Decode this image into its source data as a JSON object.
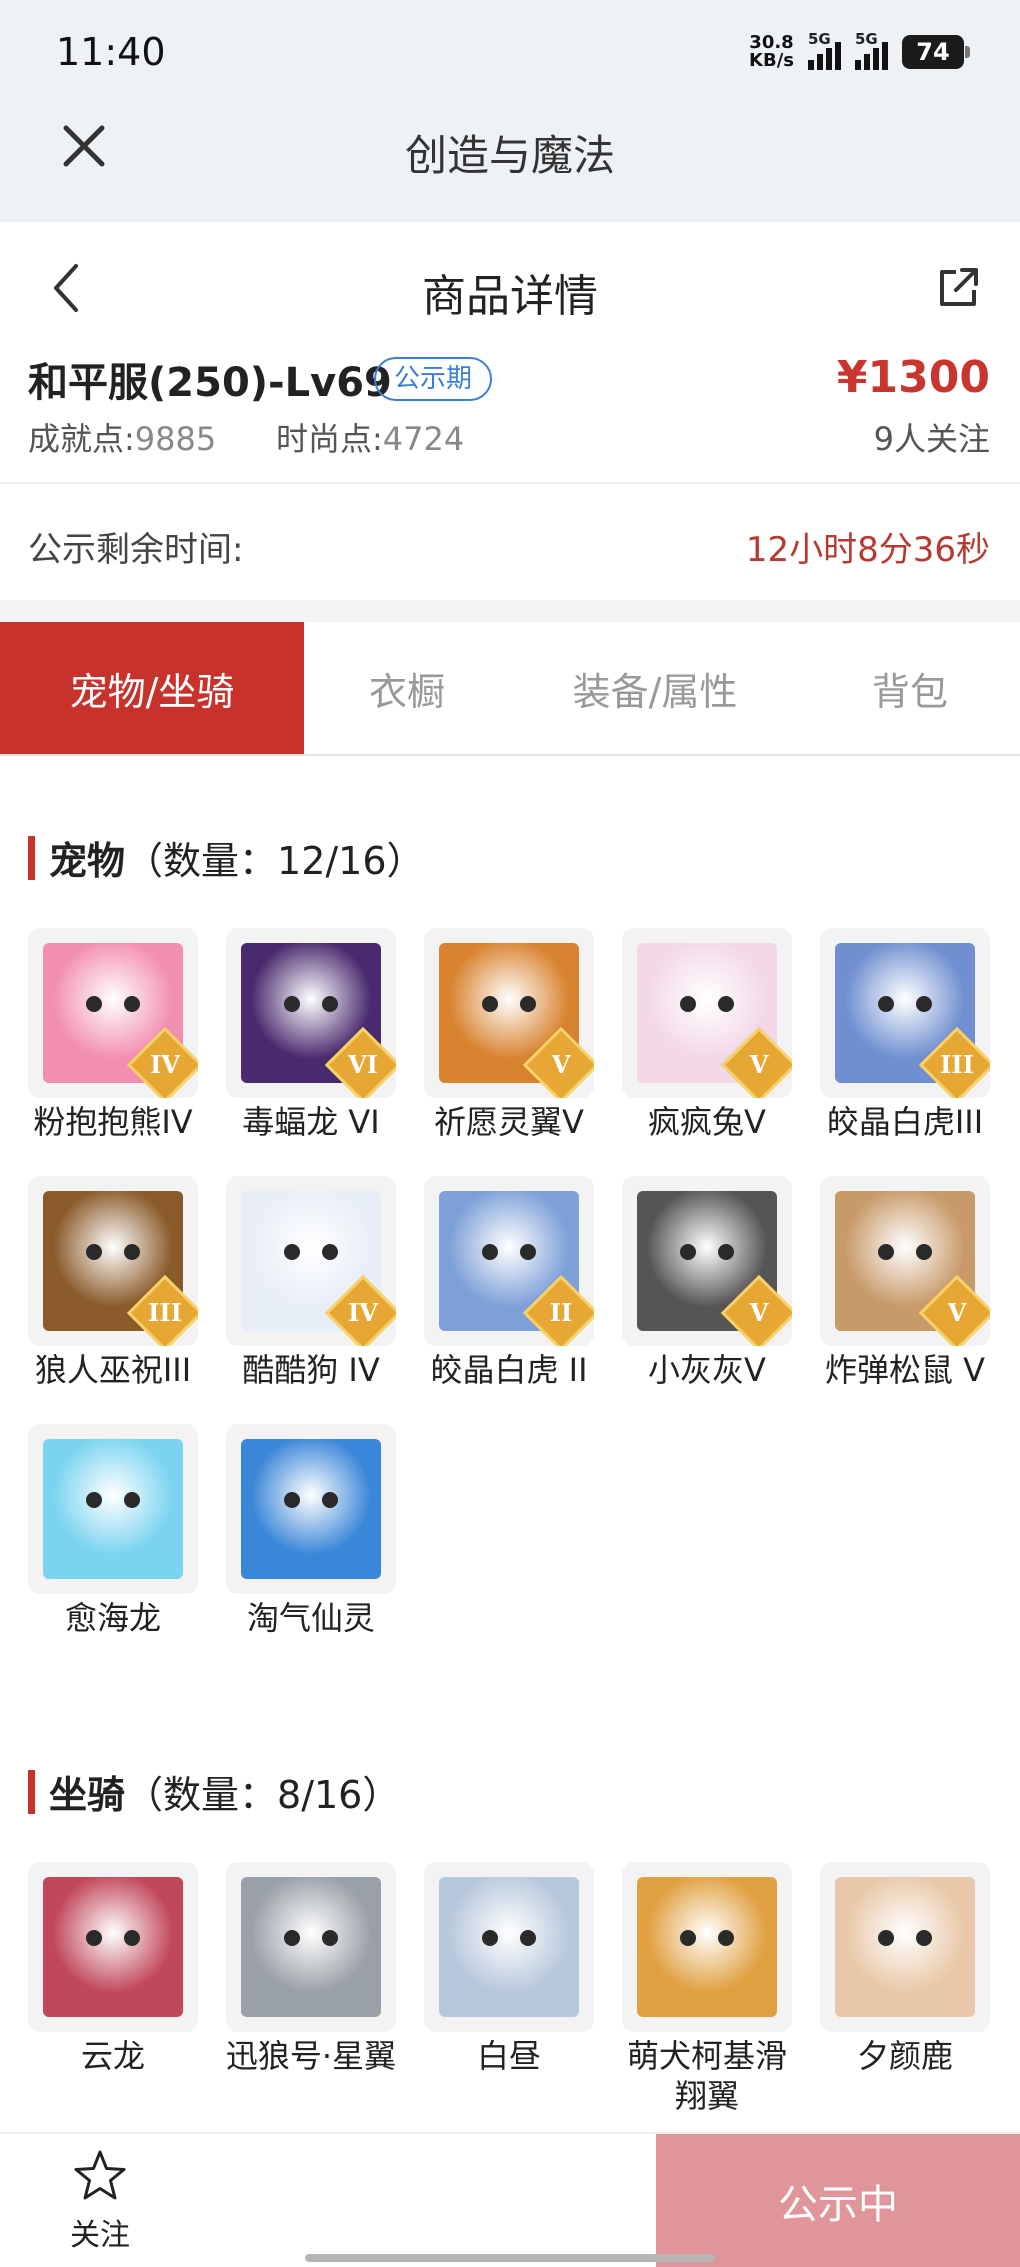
{
  "status_bar": {
    "time": "11:40",
    "net_speed_value": "30.8",
    "net_speed_unit": "KB/s",
    "signal_label_1": "5G",
    "signal_label_2": "5G",
    "battery": "74"
  },
  "app_header": {
    "title": "创造与魔法"
  },
  "page": {
    "title": "商品详情"
  },
  "product": {
    "name": "和平服(250)-Lv69",
    "badge": "公示期",
    "price": "¥1300",
    "achievement_label": "成就点:",
    "achievement_value": "9885",
    "fashion_label": "时尚点:",
    "fashion_value": "4724",
    "followers": "9人关注"
  },
  "notice": {
    "label": "公示剩余时间:",
    "value": "12小时8分36秒"
  },
  "tabs": [
    {
      "label": "宠物/坐骑",
      "active": true
    },
    {
      "label": "衣橱",
      "active": false
    },
    {
      "label": "装备/属性",
      "active": false
    },
    {
      "label": "背包",
      "active": false
    }
  ],
  "pets_section": {
    "title": "宠物",
    "count": "（数量：12/16）",
    "items": [
      {
        "name": "粉抱抱熊IV",
        "rank": "IV",
        "color": "#f28fb0"
      },
      {
        "name": "毒蝠龙 VI",
        "rank": "VI",
        "color": "#4a2a6e"
      },
      {
        "name": "祈愿灵翼V",
        "rank": "V",
        "color": "#d8832f"
      },
      {
        "name": "疯疯兔V",
        "rank": "V",
        "color": "#f3d8e8"
      },
      {
        "name": "皎晶白虎III",
        "rank": "III",
        "color": "#6f8fd0"
      },
      {
        "name": "狼人巫祝III",
        "rank": "III",
        "color": "#8a5a2a"
      },
      {
        "name": "酷酷狗 IV",
        "rank": "IV",
        "color": "#e8eef8"
      },
      {
        "name": "皎晶白虎 II",
        "rank": "II",
        "color": "#7ea0d8"
      },
      {
        "name": "小灰灰V",
        "rank": "V",
        "color": "#555555"
      },
      {
        "name": "炸弹松鼠 V",
        "rank": "V",
        "color": "#c89a6a"
      },
      {
        "name": "愈海龙",
        "rank": "",
        "color": "#7ad4f0"
      },
      {
        "name": "淘气仙灵",
        "rank": "",
        "color": "#3a86d8"
      }
    ]
  },
  "mounts_section": {
    "title": "坐骑",
    "count": "（数量：8/16）",
    "items": [
      {
        "name": "云龙",
        "color": "#c0485a"
      },
      {
        "name": "迅狼号·星翼",
        "color": "#9aa0a8"
      },
      {
        "name": "白昼",
        "color": "#b8c8dc"
      },
      {
        "name": "萌犬柯基滑翔翼",
        "color": "#e0a040"
      },
      {
        "name": "夕颜鹿",
        "color": "#e8c8a8"
      }
    ]
  },
  "bottom_bar": {
    "follow_label": "关注",
    "cta_label": "公示中"
  }
}
